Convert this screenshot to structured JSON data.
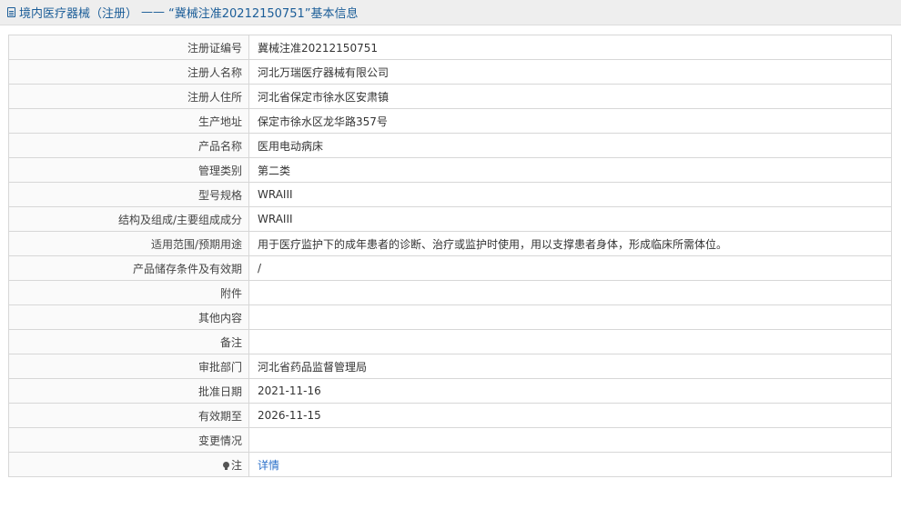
{
  "header": {
    "title": "境内医疗器械（注册）",
    "separator": "——",
    "subtitle": "“冀械注准20212150751”基本信息"
  },
  "rows": [
    {
      "label": "注册证编号",
      "value": "冀械注准20212150751"
    },
    {
      "label": "注册人名称",
      "value": "河北万瑞医疗器械有限公司"
    },
    {
      "label": "注册人住所",
      "value": "河北省保定市徐水区安肃镇"
    },
    {
      "label": "生产地址",
      "value": "保定市徐水区龙华路357号"
    },
    {
      "label": "产品名称",
      "value": "医用电动病床"
    },
    {
      "label": "管理类别",
      "value": "第二类"
    },
    {
      "label": "型号规格",
      "value": "WRAIII"
    },
    {
      "label": "结构及组成/主要组成成分",
      "value": "WRAIII"
    },
    {
      "label": "适用范围/预期用途",
      "value": "用于医疗监护下的成年患者的诊断、治疗或监护时使用，用以支撑患者身体，形成临床所需体位。"
    },
    {
      "label": "产品储存条件及有效期",
      "value": "/"
    },
    {
      "label": "附件",
      "value": ""
    },
    {
      "label": "其他内容",
      "value": ""
    },
    {
      "label": "备注",
      "value": ""
    },
    {
      "label": "审批部门",
      "value": "河北省药品监督管理局"
    },
    {
      "label": "批准日期",
      "value": "2021-11-16"
    },
    {
      "label": "有效期至",
      "value": "2026-11-15"
    },
    {
      "label": "变更情况",
      "value": ""
    }
  ],
  "note": {
    "label": "注",
    "link_label": "详情",
    "icon": "bulb-icon"
  },
  "colors": {
    "header_text": "#1b5d98",
    "link": "#2a6fc9",
    "border": "#d7d7d7"
  }
}
